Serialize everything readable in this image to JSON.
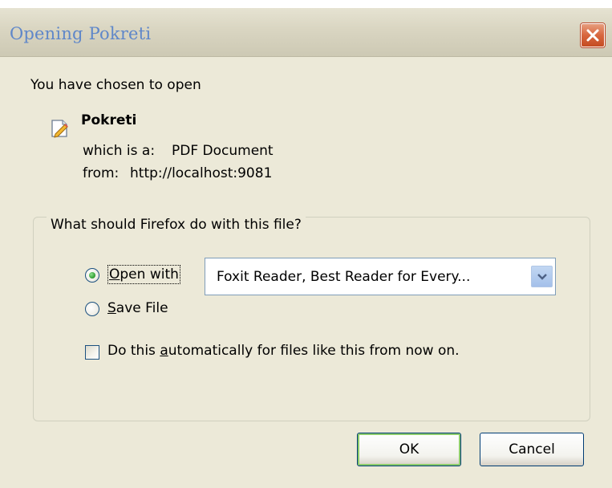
{
  "window": {
    "title": "Opening Pokreti"
  },
  "dialog": {
    "intro": "You have chosen to open",
    "file_icon": "document-pencil-icon",
    "file_name": "Pokreti",
    "type_label": "which is a:",
    "type_value": "PDF Document",
    "from_label": "from:",
    "from_value": "http://localhost:9081"
  },
  "group": {
    "legend": "What should Firefox do with this file?",
    "open_with": {
      "label": "Open with",
      "checked": true
    },
    "application_select": {
      "value": "Foxit Reader, Best Reader for Every..."
    },
    "save_file": {
      "label": "Save File",
      "checked": false
    },
    "auto_checkbox": {
      "label": "Do this automatically for files like this from now on.",
      "checked": false
    }
  },
  "buttons": {
    "ok": "OK",
    "cancel": "Cancel"
  },
  "colors": {
    "title_text": "#5f87c9",
    "close_button": "#d8663e",
    "dialog_bg": "#ece9d8",
    "radio_dot": "#3aa53a"
  }
}
